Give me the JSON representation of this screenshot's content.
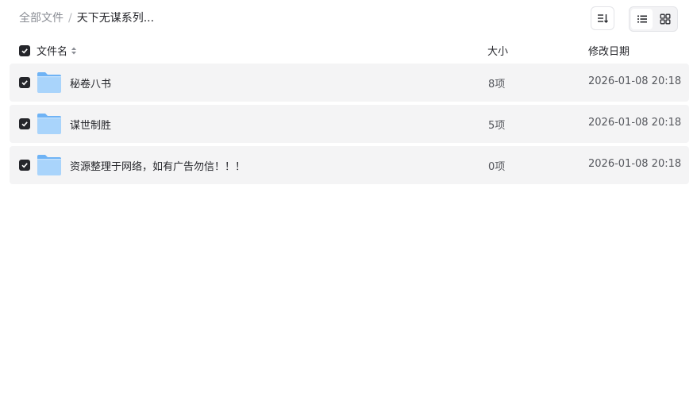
{
  "breadcrumb": {
    "root": "全部文件",
    "separator": "/",
    "current": "天下无谋系列..."
  },
  "toolbar": {
    "sort_icon": "sort-icon",
    "view_list_icon": "list-view-icon",
    "view_grid_icon": "grid-view-icon",
    "active_view": "list"
  },
  "table": {
    "headers": {
      "name": "文件名",
      "size": "大小",
      "modified": "修改日期"
    },
    "select_all_checked": true,
    "rows": [
      {
        "name": "秘卷八书",
        "size": "8项",
        "modified": "2026-01-08 20:18",
        "checked": true,
        "icon": "folder-icon"
      },
      {
        "name": "谋世制胜",
        "size": "5项",
        "modified": "2026-01-08 20:18",
        "checked": true,
        "icon": "folder-icon"
      },
      {
        "name": "资源整理于网络，如有广告勿信！！！",
        "size": "0项",
        "modified": "2026-01-08 20:18",
        "checked": true,
        "icon": "folder-icon"
      }
    ]
  },
  "colors": {
    "row_bg": "#f4f4f5",
    "checkbox": "#25262b",
    "folder_light": "#a9d4fb",
    "folder_dark": "#6fb3f5"
  }
}
